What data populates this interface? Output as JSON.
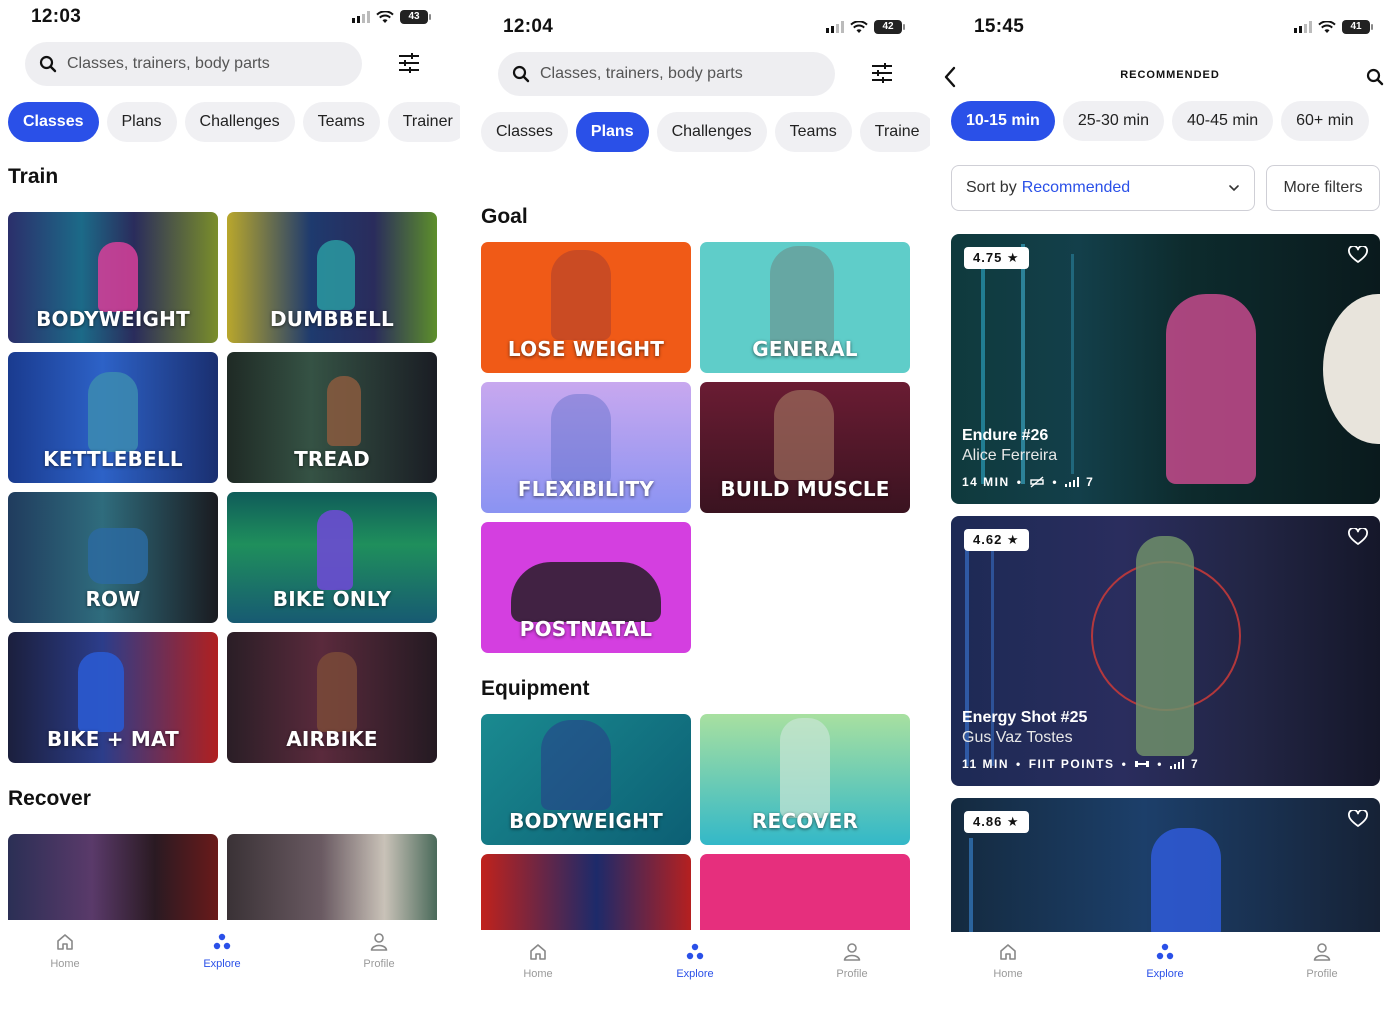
{
  "screens": [
    {
      "time": "12:03",
      "battery": "43",
      "search_placeholder": "Classes, trainers, body parts",
      "chips": [
        "Classes",
        "Plans",
        "Challenges",
        "Teams",
        "Trainer"
      ],
      "active_chip": "Classes",
      "sections": [
        {
          "title": "Train",
          "tiles": [
            "BODYWEIGHT",
            "DUMBBELL",
            "KETTLEBELL",
            "TREAD",
            "ROW",
            "BIKE ONLY",
            "BIKE + MAT",
            "AIRBIKE"
          ]
        },
        {
          "title": "Recover"
        }
      ],
      "nav": [
        "Home",
        "Explore",
        "Profile"
      ],
      "nav_active": "Explore"
    },
    {
      "time": "12:04",
      "battery": "42",
      "search_placeholder": "Classes, trainers, body parts",
      "chips": [
        "Classes",
        "Plans",
        "Challenges",
        "Teams",
        "Traine"
      ],
      "active_chip": "Plans",
      "sections": [
        {
          "title": "Goal",
          "tiles": [
            "LOSE WEIGHT",
            "GENERAL",
            "FLEXIBILITY",
            "BUILD MUSCLE",
            "POSTNATAL"
          ]
        },
        {
          "title": "Equipment",
          "tiles": [
            "BODYWEIGHT",
            "RECOVER"
          ]
        }
      ],
      "nav": [
        "Home",
        "Explore",
        "Profile"
      ],
      "nav_active": "Explore"
    },
    {
      "time": "15:45",
      "battery": "41",
      "header_title": "RECOMMENDED",
      "chips": [
        "10-15 min",
        "25-30 min",
        "40-45 min",
        "60+ min"
      ],
      "active_chip": "10-15 min",
      "sort_label": "Sort by",
      "sort_value": "Recommended",
      "more_filters": "More filters",
      "cards": [
        {
          "rating": "4.75 ★",
          "name": "Endure #26",
          "trainer": "Alice Ferreira",
          "meta_duration": "14 MIN",
          "meta_level": "7"
        },
        {
          "rating": "4.62 ★",
          "name": "Energy Shot #25",
          "trainer": "Gus Vaz Tostes",
          "meta_duration": "11 MIN",
          "meta_points": "FIIT POINTS",
          "meta_level": "7"
        },
        {
          "rating": "4.86 ★"
        }
      ],
      "nav": [
        "Home",
        "Explore",
        "Profile"
      ],
      "nav_active": "Explore"
    }
  ],
  "colors": {
    "accent": "#2a50e8",
    "chip_bg": "#f0f0f3",
    "tile_orange": "#f05a17",
    "tile_teal": "#5fcdc9",
    "tile_lavender": "#a9a8f0",
    "tile_maroon": "#5a1a2c",
    "tile_magenta": "#d43fe0",
    "tile_deepteal": "#0f7a86",
    "tile_mint": "#7ed9b9",
    "tile_red": "#d7261e",
    "tile_pink": "#e62f7d"
  },
  "icons": [
    "search-icon",
    "filter-sliders-icon",
    "back-chevron-icon",
    "heart-icon",
    "home-icon",
    "explore-icon",
    "profile-icon",
    "chevron-down-icon"
  ]
}
